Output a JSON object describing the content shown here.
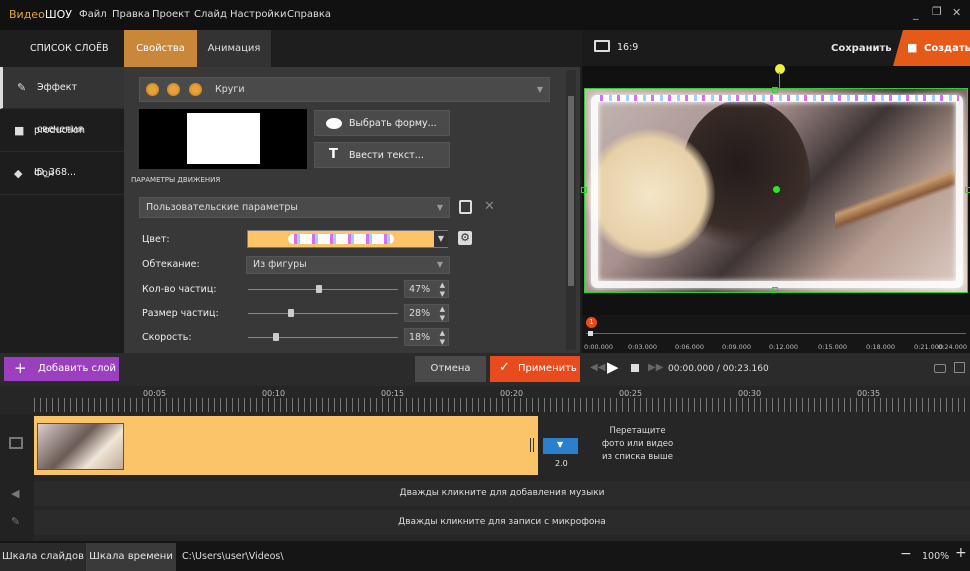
{
  "app": {
    "logo_part1": "Видео",
    "logo_part2": "ШОУ"
  },
  "menu": [
    "Файл",
    "Правка",
    "Проект",
    "Слайд",
    "Настройки",
    "Справка"
  ],
  "window_controls": [
    "minimize",
    "restore",
    "close"
  ],
  "layers_header": "СПИСОК СЛОЁВ",
  "tabs": [
    {
      "label": "Свойства",
      "active": true
    },
    {
      "label": "Анимация",
      "active": false
    }
  ],
  "layers": [
    {
      "label": "Эффект свечения",
      "icon": "magic-wand-icon"
    },
    {
      "label": "production ID_368...",
      "icon": "clapper-icon"
    },
    {
      "label": "Фон",
      "icon": "fill-bucket-icon"
    }
  ],
  "props": {
    "shape_preset": "Круги",
    "choose_shape_button": "Выбрать форму...",
    "enter_text_button": "Ввести текст...",
    "motion_title": "ПАРАМЕТРЫ ДВИЖЕНИЯ",
    "motion_preset": "Пользовательские параметры",
    "color_label": "Цвет:",
    "wrap_label": "Обтекание:",
    "wrap_value": "Из фигуры",
    "count_label": "Кол-во частиц:",
    "count_value": "47%",
    "count_level": 0.47,
    "size_label": "Размер частиц:",
    "size_value": "28%",
    "size_level": 0.28,
    "speed_label": "Скорость:",
    "speed_value": "18%",
    "speed_level": 0.18
  },
  "preview": {
    "aspect": "16:9",
    "save_label": "Сохранить",
    "create_label": "Создать"
  },
  "preview_ruler": {
    "marker": "1",
    "ticks": [
      "0:00.000",
      "0:03.000",
      "0:06.000",
      "0:09.000",
      "0:12.000",
      "0:15.000",
      "0:18.000",
      "0:21.000",
      "0:24.000"
    ]
  },
  "actions": {
    "add_layer": "Добавить слой",
    "cancel": "Отмена",
    "apply": "Применить",
    "time": "00:00.000 / 00:23.160"
  },
  "timeline": {
    "ticks": [
      "00:05",
      "00:10",
      "00:15",
      "00:20",
      "00:25",
      "00:30",
      "00:35"
    ],
    "transition_value": "2.0",
    "drop_hint_line1": "Перетащите",
    "drop_hint_line2": "фото или видео",
    "drop_hint_line3": "из списка выше",
    "music_hint": "Дважды кликните для добавления музыки",
    "mic_hint": "Дважды кликните для записи с микрофона"
  },
  "bottom": {
    "slides_tab": "Шкала слайдов",
    "timeline_tab": "Шкала времени",
    "path": "C:\\Users\\user\\Videos\\",
    "zoom": "100%"
  },
  "colors": {
    "accent_orange": "#e8a33a",
    "apply_red": "#e84c1e",
    "add_layer_purple": "#9b3fbf",
    "create_orange": "#e65a17",
    "clip_yellow": "#fcc468"
  }
}
